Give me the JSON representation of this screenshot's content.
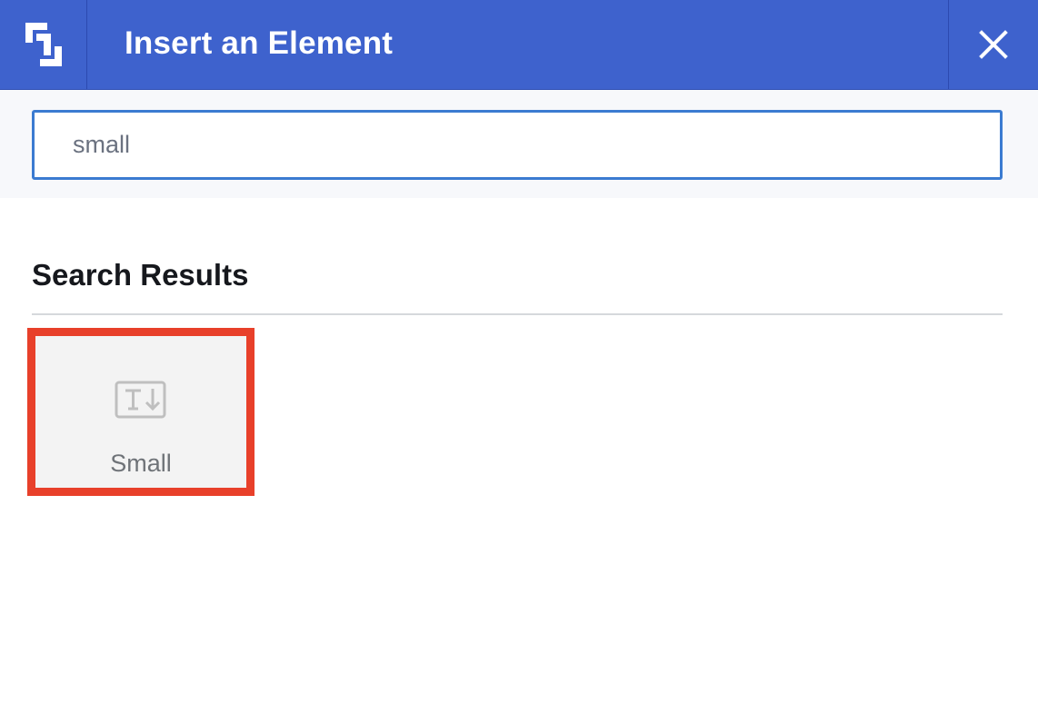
{
  "header": {
    "title": "Insert an Element",
    "logo_icon": "builder-logo-icon",
    "close_icon": "close-icon"
  },
  "search": {
    "value": "small",
    "placeholder": ""
  },
  "results": {
    "heading": "Search Results",
    "items": [
      {
        "label": "Small",
        "icon": "text-small-icon"
      }
    ]
  },
  "colors": {
    "header_bg": "#3e62cd",
    "search_border": "#3b7bd1",
    "highlight_border": "#e8402a",
    "card_bg": "#f3f3f3"
  }
}
